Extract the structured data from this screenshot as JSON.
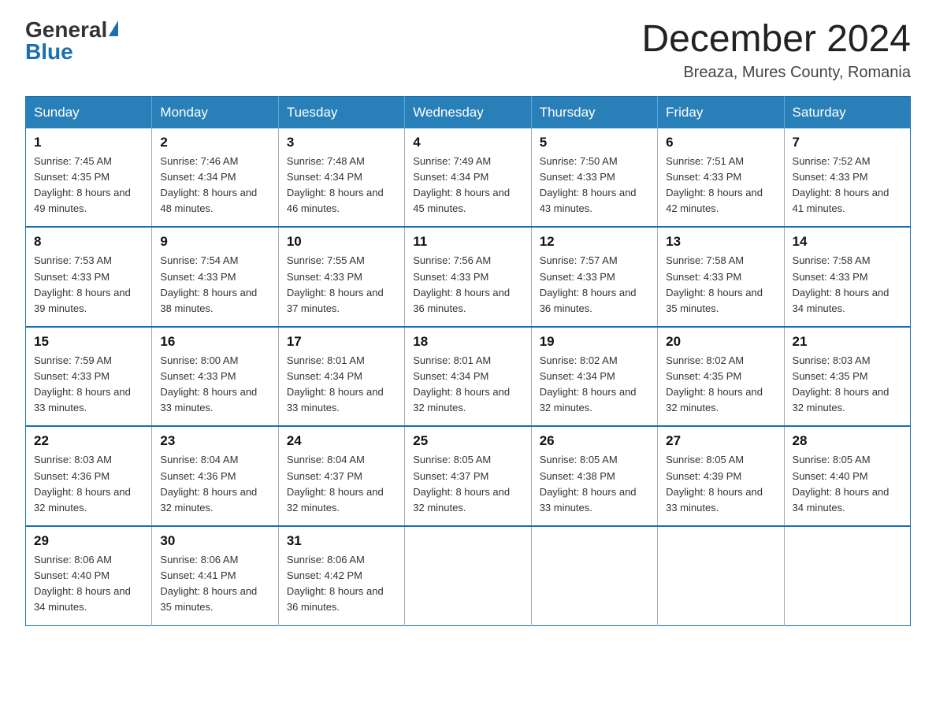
{
  "header": {
    "logo_general": "General",
    "logo_blue": "Blue",
    "month_title": "December 2024",
    "location": "Breaza, Mures County, Romania"
  },
  "days_of_week": [
    "Sunday",
    "Monday",
    "Tuesday",
    "Wednesday",
    "Thursday",
    "Friday",
    "Saturday"
  ],
  "weeks": [
    [
      {
        "day": "1",
        "sunrise": "7:45 AM",
        "sunset": "4:35 PM",
        "daylight": "8 hours and 49 minutes."
      },
      {
        "day": "2",
        "sunrise": "7:46 AM",
        "sunset": "4:34 PM",
        "daylight": "8 hours and 48 minutes."
      },
      {
        "day": "3",
        "sunrise": "7:48 AM",
        "sunset": "4:34 PM",
        "daylight": "8 hours and 46 minutes."
      },
      {
        "day": "4",
        "sunrise": "7:49 AM",
        "sunset": "4:34 PM",
        "daylight": "8 hours and 45 minutes."
      },
      {
        "day": "5",
        "sunrise": "7:50 AM",
        "sunset": "4:33 PM",
        "daylight": "8 hours and 43 minutes."
      },
      {
        "day": "6",
        "sunrise": "7:51 AM",
        "sunset": "4:33 PM",
        "daylight": "8 hours and 42 minutes."
      },
      {
        "day": "7",
        "sunrise": "7:52 AM",
        "sunset": "4:33 PM",
        "daylight": "8 hours and 41 minutes."
      }
    ],
    [
      {
        "day": "8",
        "sunrise": "7:53 AM",
        "sunset": "4:33 PM",
        "daylight": "8 hours and 39 minutes."
      },
      {
        "day": "9",
        "sunrise": "7:54 AM",
        "sunset": "4:33 PM",
        "daylight": "8 hours and 38 minutes."
      },
      {
        "day": "10",
        "sunrise": "7:55 AM",
        "sunset": "4:33 PM",
        "daylight": "8 hours and 37 minutes."
      },
      {
        "day": "11",
        "sunrise": "7:56 AM",
        "sunset": "4:33 PM",
        "daylight": "8 hours and 36 minutes."
      },
      {
        "day": "12",
        "sunrise": "7:57 AM",
        "sunset": "4:33 PM",
        "daylight": "8 hours and 36 minutes."
      },
      {
        "day": "13",
        "sunrise": "7:58 AM",
        "sunset": "4:33 PM",
        "daylight": "8 hours and 35 minutes."
      },
      {
        "day": "14",
        "sunrise": "7:58 AM",
        "sunset": "4:33 PM",
        "daylight": "8 hours and 34 minutes."
      }
    ],
    [
      {
        "day": "15",
        "sunrise": "7:59 AM",
        "sunset": "4:33 PM",
        "daylight": "8 hours and 33 minutes."
      },
      {
        "day": "16",
        "sunrise": "8:00 AM",
        "sunset": "4:33 PM",
        "daylight": "8 hours and 33 minutes."
      },
      {
        "day": "17",
        "sunrise": "8:01 AM",
        "sunset": "4:34 PM",
        "daylight": "8 hours and 33 minutes."
      },
      {
        "day": "18",
        "sunrise": "8:01 AM",
        "sunset": "4:34 PM",
        "daylight": "8 hours and 32 minutes."
      },
      {
        "day": "19",
        "sunrise": "8:02 AM",
        "sunset": "4:34 PM",
        "daylight": "8 hours and 32 minutes."
      },
      {
        "day": "20",
        "sunrise": "8:02 AM",
        "sunset": "4:35 PM",
        "daylight": "8 hours and 32 minutes."
      },
      {
        "day": "21",
        "sunrise": "8:03 AM",
        "sunset": "4:35 PM",
        "daylight": "8 hours and 32 minutes."
      }
    ],
    [
      {
        "day": "22",
        "sunrise": "8:03 AM",
        "sunset": "4:36 PM",
        "daylight": "8 hours and 32 minutes."
      },
      {
        "day": "23",
        "sunrise": "8:04 AM",
        "sunset": "4:36 PM",
        "daylight": "8 hours and 32 minutes."
      },
      {
        "day": "24",
        "sunrise": "8:04 AM",
        "sunset": "4:37 PM",
        "daylight": "8 hours and 32 minutes."
      },
      {
        "day": "25",
        "sunrise": "8:05 AM",
        "sunset": "4:37 PM",
        "daylight": "8 hours and 32 minutes."
      },
      {
        "day": "26",
        "sunrise": "8:05 AM",
        "sunset": "4:38 PM",
        "daylight": "8 hours and 33 minutes."
      },
      {
        "day": "27",
        "sunrise": "8:05 AM",
        "sunset": "4:39 PM",
        "daylight": "8 hours and 33 minutes."
      },
      {
        "day": "28",
        "sunrise": "8:05 AM",
        "sunset": "4:40 PM",
        "daylight": "8 hours and 34 minutes."
      }
    ],
    [
      {
        "day": "29",
        "sunrise": "8:06 AM",
        "sunset": "4:40 PM",
        "daylight": "8 hours and 34 minutes."
      },
      {
        "day": "30",
        "sunrise": "8:06 AM",
        "sunset": "4:41 PM",
        "daylight": "8 hours and 35 minutes."
      },
      {
        "day": "31",
        "sunrise": "8:06 AM",
        "sunset": "4:42 PM",
        "daylight": "8 hours and 36 minutes."
      },
      null,
      null,
      null,
      null
    ]
  ]
}
